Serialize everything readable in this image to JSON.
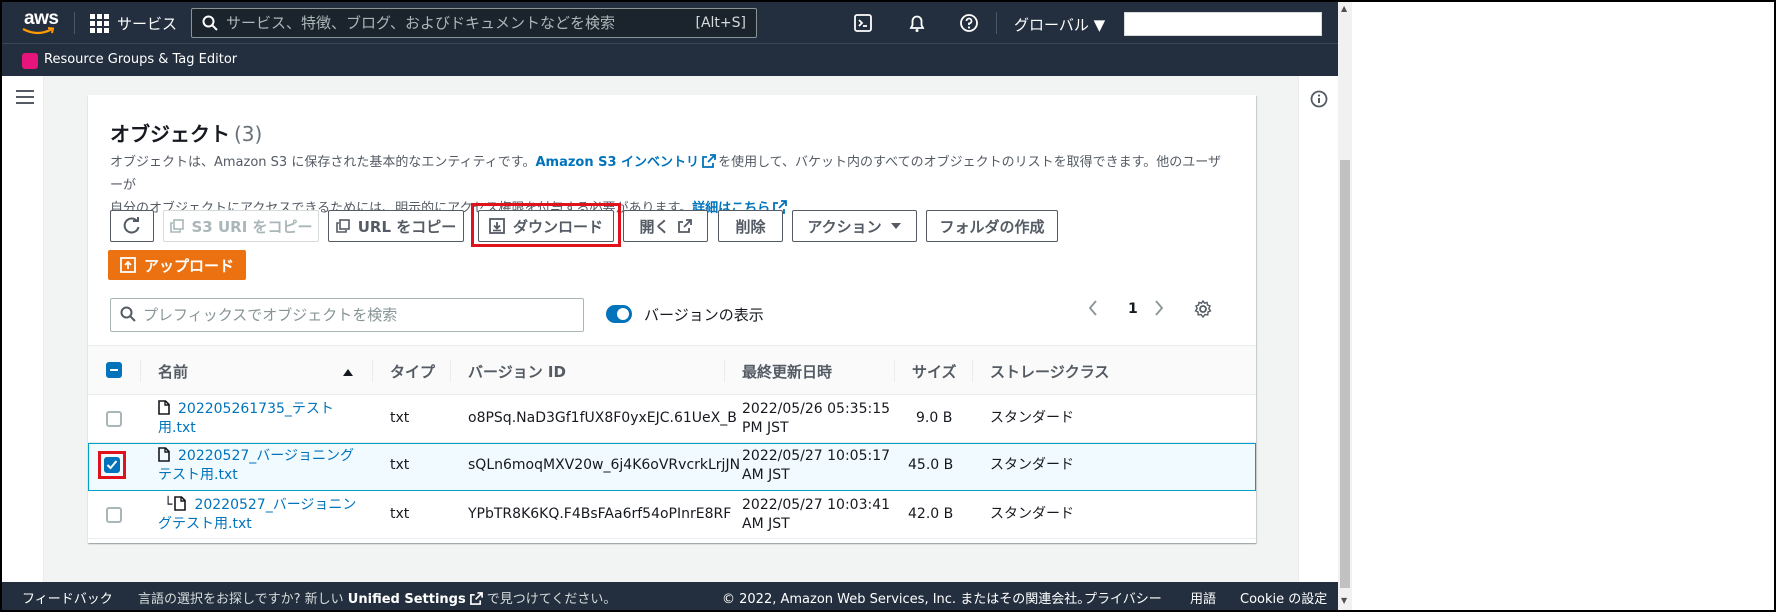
{
  "nav": {
    "logo": "aws",
    "services": "サービス",
    "search_placeholder": "サービス、特徴、ブログ、およびドキュメントなどを検索",
    "search_shortcut": "[Alt+S]",
    "region": "グローバル ▼"
  },
  "subnav": {
    "resource_groups": "Resource Groups & Tag Editor"
  },
  "objects": {
    "title": "オブジェクト",
    "count": "(3)",
    "desc_1": "オブジェクトは、Amazon S3 に保存された基本的なエンティティです。",
    "inventory_link": "Amazon S3 インベントリ",
    "desc_2": "を使用して、バケット内のすべてのオブジェクトのリストを取得できます。他のユーザーが",
    "desc_3": "自分のオブジェクトにアクセスできるためには、明示的にアクセス権限を付与する必要があります。",
    "details_link": "詳細はこちら"
  },
  "toolbar": {
    "copy_s3_uri": "S3 URI をコピー",
    "copy_url": "URL をコピー",
    "download": "ダウンロード",
    "open": "開く",
    "delete": "削除",
    "actions": "アクション",
    "create_folder": "フォルダの作成",
    "upload": "アップロード"
  },
  "filter": {
    "placeholder": "プレフィックスでオブジェクトを検索",
    "show_versions": "バージョンの表示",
    "page": "1"
  },
  "table": {
    "headers": [
      "名前",
      "タイプ",
      "バージョン ID",
      "最終更新日時",
      "サイズ",
      "ストレージクラス"
    ],
    "rows": [
      {
        "name_1": "202205261735_テスト",
        "name_2": "用.txt",
        "type": "txt",
        "version": "o8PSq.NaD3Gf1fUX8F0yxEJC.61UeX_B",
        "date_1": "2022/05/26 05:35:15",
        "date_2": "PM JST",
        "size": "9.0 B",
        "storage": "スタンダード",
        "checked": false
      },
      {
        "name_1": "20220527_バージョニング",
        "name_2": "テスト用.txt",
        "type": "txt",
        "version": "sQLn6moqMXV20w_6j4K6oVRvcrkLrjJN",
        "date_1": "2022/05/27 10:05:17",
        "date_2": "AM JST",
        "size": "45.0 B",
        "storage": "スタンダード",
        "checked": true
      },
      {
        "name_1": "20220527_バージョニン",
        "name_2": "グテスト用.txt",
        "type": "txt",
        "version": "YPbTR8K6KQ.F4BsFAa6rf54oPInrE8RF",
        "date_1": "2022/05/27 10:03:41",
        "date_2": "AM JST",
        "size": "42.0 B",
        "storage": "スタンダード",
        "checked": false
      }
    ]
  },
  "footer": {
    "feedback": "フィードバック",
    "lang_prompt": "言語の選択をお探しですか? 新しい",
    "unified_settings": "Unified Settings",
    "lang_suffix": "で見つけてください。",
    "copyright": "© 2022, Amazon Web Services, Inc. またはその関連会社。",
    "privacy": "プライバシー",
    "terms": "用語",
    "cookie": "Cookie の設定"
  },
  "colors": {
    "nav_bg": "#232f3e",
    "link": "#0073bb",
    "primary": "#ec7211",
    "highlight": "#e0121b"
  }
}
